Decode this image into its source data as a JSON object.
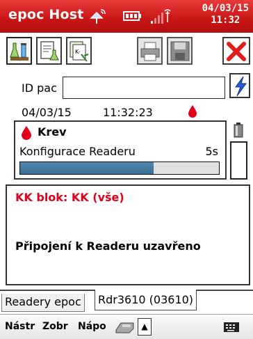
{
  "titlebar": {
    "title": "epoc Host",
    "date": "04/03/15",
    "time": "11:32",
    "icons": [
      "satellite-sync-icon",
      "battery-icon",
      "signal-strength-icon"
    ]
  },
  "toolbar": {
    "buttons": [
      "lab-flasks-icon",
      "report-flask-icon",
      "qc-test-icon",
      "printer-icon",
      "save-disk-icon",
      "cancel-x-icon"
    ]
  },
  "patient": {
    "id_label": "ID pac",
    "id_value": "",
    "date": "04/03/15",
    "time": "11:32:23"
  },
  "status": {
    "sample_type": "Krev",
    "task": "Konfigurace Readeru",
    "remaining": "5s",
    "progress_fraction": 0.67
  },
  "messages": {
    "qc_block": "KK blok: KK (vše)",
    "connection": "Připojení k Readeru uzavřeno"
  },
  "tabs": [
    "Readery epoc",
    "Rdr3610 (03610)"
  ],
  "menubar": {
    "items": [
      "Nástr",
      "Zobr",
      "Nápo"
    ]
  },
  "colors": {
    "titlebar": "#c81414",
    "alert_red": "#e3001b",
    "progress_fill": "#3b6f95",
    "bolt_blue": "#2a5bd7"
  }
}
